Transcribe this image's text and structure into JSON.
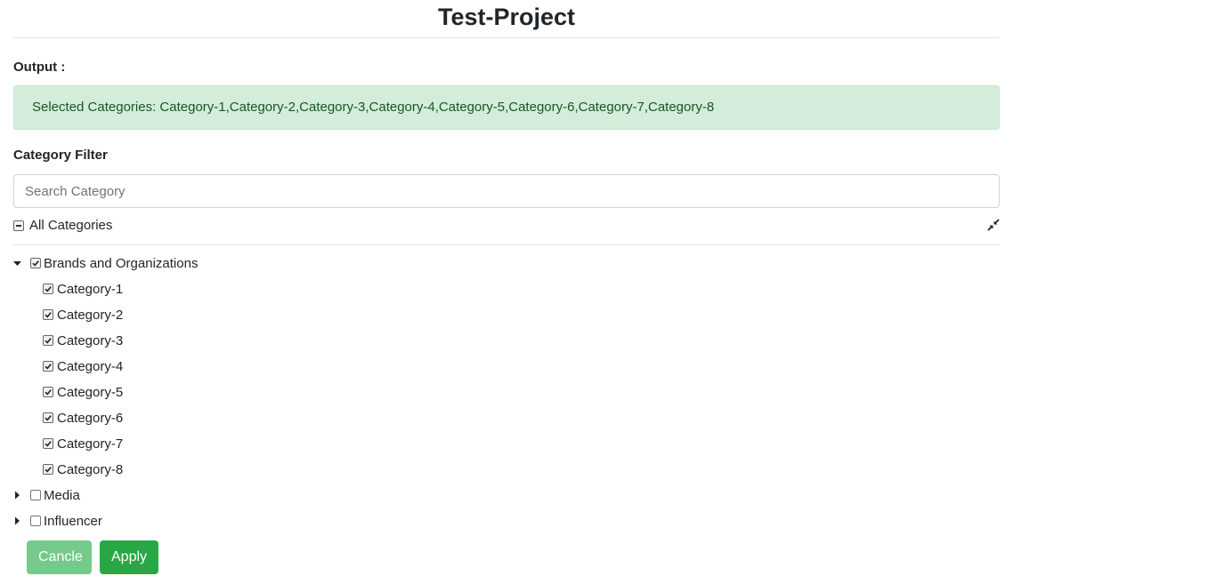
{
  "page": {
    "title": "Test-Project"
  },
  "output": {
    "label": "Output :",
    "message": "Selected Categories: Category-1,Category-2,Category-3,Category-4,Category-5,Category-6,Category-7,Category-8"
  },
  "filter": {
    "label": "Category Filter",
    "search_placeholder": "Search Category",
    "search_value": "",
    "all_label": "All Categories",
    "all_state": "indeterminate"
  },
  "tree": {
    "groups": [
      {
        "label": "Brands and Organizations",
        "expanded": true,
        "checked": true,
        "children": [
          {
            "label": "Category-1",
            "checked": true
          },
          {
            "label": "Category-2",
            "checked": true
          },
          {
            "label": "Category-3",
            "checked": true
          },
          {
            "label": "Category-4",
            "checked": true
          },
          {
            "label": "Category-5",
            "checked": true
          },
          {
            "label": "Category-6",
            "checked": true
          },
          {
            "label": "Category-7",
            "checked": true
          },
          {
            "label": "Category-8",
            "checked": true
          }
        ]
      },
      {
        "label": "Media",
        "expanded": false,
        "checked": false,
        "children": []
      },
      {
        "label": "Influencer",
        "expanded": false,
        "checked": false,
        "children": []
      }
    ]
  },
  "buttons": {
    "cancel_label": "Cancle",
    "apply_label": "Apply"
  },
  "colors": {
    "alert_bg": "#d4edda",
    "alert_text": "#155724",
    "apply_bg": "#28a745",
    "cancel_bg": "#75c98a"
  },
  "icons": {
    "collapse_all": "compress-icon",
    "expanded_caret": "caret-down-icon",
    "collapsed_caret": "caret-right-icon"
  }
}
